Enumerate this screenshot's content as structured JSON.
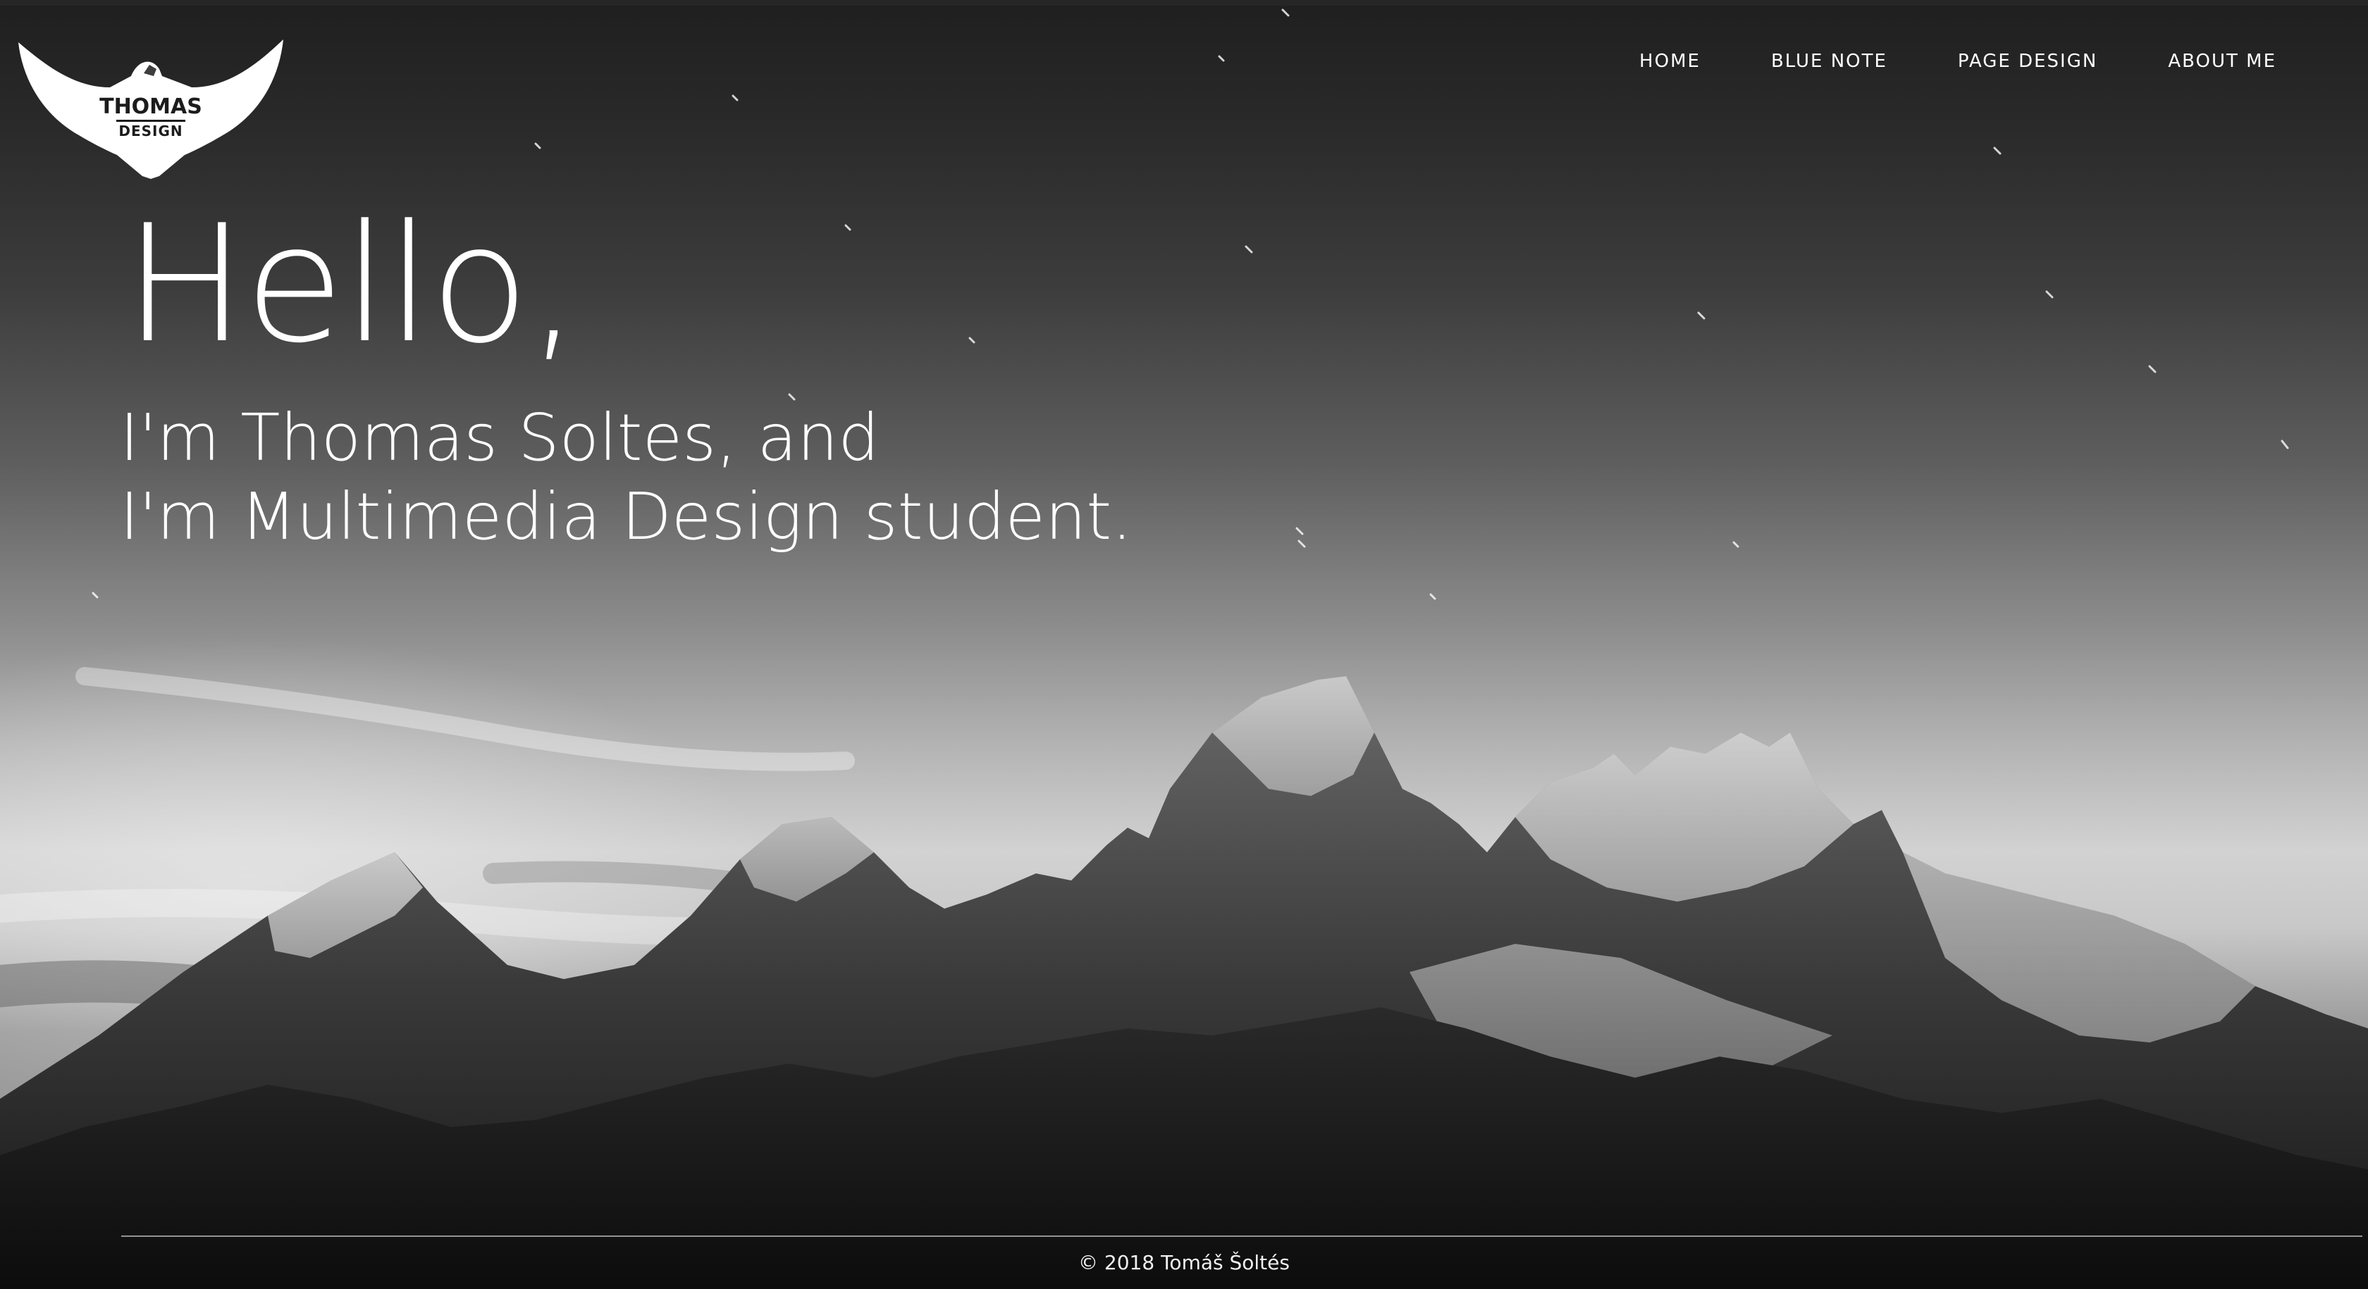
{
  "logo": {
    "title": "THOMAS",
    "subtitle": "DESIGN",
    "icon": "eagle-icon"
  },
  "nav": {
    "items": [
      {
        "label": "HOME"
      },
      {
        "label": "BLUE NOTE"
      },
      {
        "label": "PAGE DESIGN"
      },
      {
        "label": "ABOUT ME"
      }
    ]
  },
  "hero": {
    "greeting": "Hello,",
    "line1": "I'm Thomas Soltes, and",
    "line2": "I'm Multimedia Design student."
  },
  "footer": {
    "copyright": "© 2018 Tomáš Šoltés"
  },
  "colors": {
    "text": "#ffffff",
    "background": "#1e1e1e",
    "logo_fill": "#ffffff",
    "logo_text": "#1c1c1c"
  }
}
